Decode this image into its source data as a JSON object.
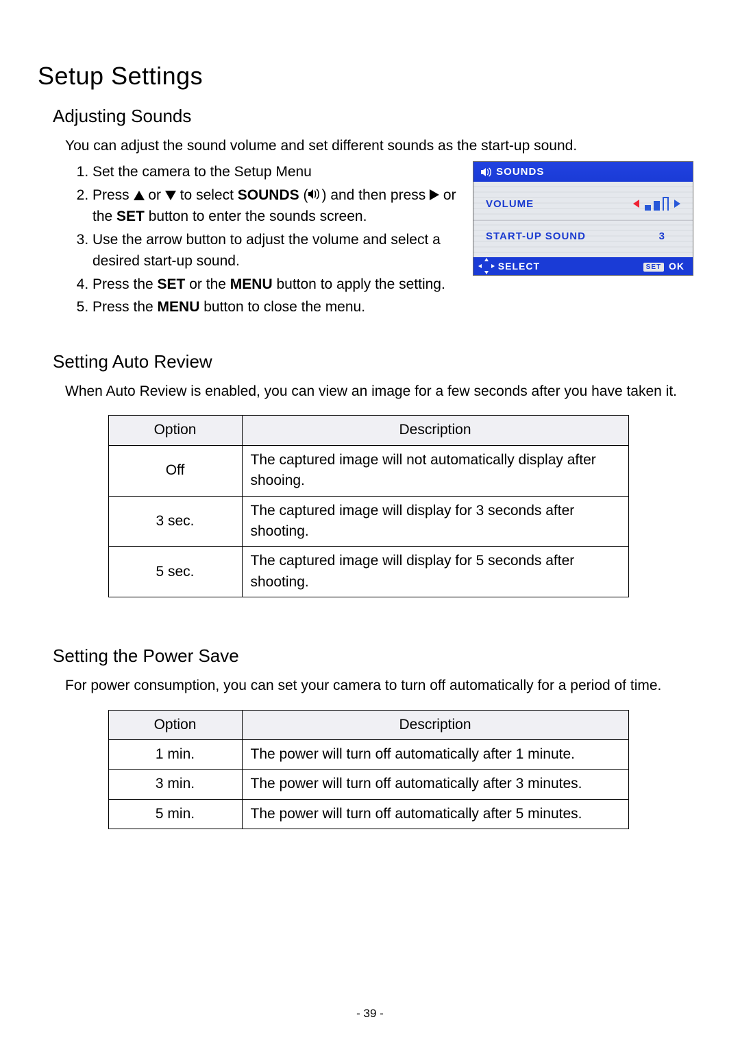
{
  "page_number_display": "- 39 -",
  "h1": "Setup Settings",
  "sounds": {
    "heading": "Adjusting Sounds",
    "intro": "You can adjust the sound volume and set different sounds as the start-up sound.",
    "steps": {
      "s1": "Set the camera to the Setup Menu",
      "s2a": "Press ",
      "s2b": " or ",
      "s2c": " to select ",
      "s2_sounds": "SOUNDS",
      "s2d": " and then press ",
      "s2e": " or the ",
      "s2_set": "SET",
      "s2f": " button to enter the sounds screen.",
      "s3": "Use the arrow button to adjust the volume and select a desired start-up sound.",
      "s4a": "Press the ",
      "s4_set": "SET",
      "s4b": " or the ",
      "s4_menu": "MENU",
      "s4c": " button to apply the setting.",
      "s5a": "Press the ",
      "s5_menu": "MENU",
      "s5b": " button to close the menu."
    },
    "lcd": {
      "title": "SOUNDS",
      "row_volume": "VOLUME",
      "row_startup": "START-UP SOUND",
      "startup_value": "3",
      "footer_select": "SELECT",
      "footer_set": "SET",
      "footer_ok": "OK"
    }
  },
  "auto_review": {
    "heading": "Setting Auto Review",
    "intro": "When Auto Review is enabled, you can view an image for a few seconds after you have taken it.",
    "th_option": "Option",
    "th_desc": "Description",
    "rows": [
      {
        "o": "Off",
        "d": "The captured image will not automatically display after shooing."
      },
      {
        "o": "3 sec.",
        "d": "The captured image will display for 3 seconds after shooting."
      },
      {
        "o": "5 sec.",
        "d": "The captured image will display for 5 seconds after shooting."
      }
    ]
  },
  "power_save": {
    "heading": "Setting the Power Save",
    "intro": "For power consumption, you can set your camera to turn off automatically for a period of time.",
    "th_option": "Option",
    "th_desc": "Description",
    "rows": [
      {
        "o": "1 min.",
        "d": "The power will turn off automatically after 1 minute."
      },
      {
        "o": "3 min.",
        "d": "The power will turn off automatically after 3 minutes."
      },
      {
        "o": "5 min.",
        "d": "The power will turn off automatically after 5 minutes."
      }
    ]
  }
}
